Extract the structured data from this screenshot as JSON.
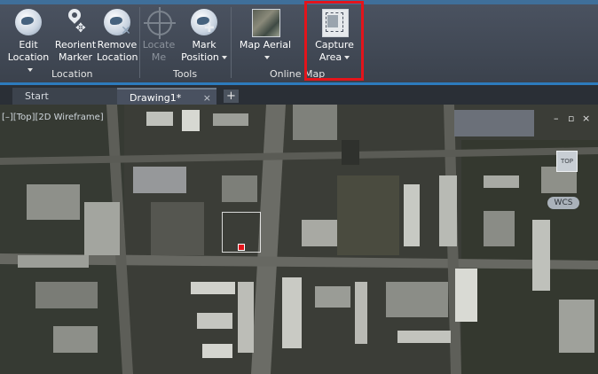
{
  "ribbon": {
    "location_panel": {
      "title": "Location",
      "buttons": [
        {
          "label": "Edit\nLocation",
          "icon": "globe-edit-icon",
          "has_dropdown": true
        },
        {
          "label": "Reorient\nMarker",
          "icon": "pin-move-icon",
          "has_dropdown": false
        },
        {
          "label": "Remove\nLocation",
          "icon": "globe-remove-icon",
          "has_dropdown": false
        }
      ]
    },
    "tools_panel": {
      "title": "Tools",
      "buttons": [
        {
          "label": "Locate\nMe",
          "icon": "crosshair-icon",
          "enabled": false
        },
        {
          "label": "Mark\nPosition",
          "icon": "globe-mark-icon",
          "has_dropdown": true
        }
      ]
    },
    "online_panel": {
      "title": "Online Map",
      "buttons": [
        {
          "label": "Map Aerial",
          "icon": "aerial-map-icon",
          "has_dropdown": true
        },
        {
          "label": "Capture\nArea",
          "icon": "capture-area-icon",
          "has_dropdown": true
        }
      ]
    },
    "highlight_color": "#e3141b"
  },
  "tabs": [
    {
      "label": "Start",
      "active": false
    },
    {
      "label": "Drawing1*",
      "active": true,
      "close": "×"
    }
  ],
  "add_tab": "+",
  "viewport": {
    "label": "[–][Top][2D Wireframe]",
    "window_controls": [
      "–",
      "▫",
      "×"
    ],
    "viewcube_label": "TOP",
    "wcs_label": "WCS",
    "marker_color": "#e3141b"
  }
}
